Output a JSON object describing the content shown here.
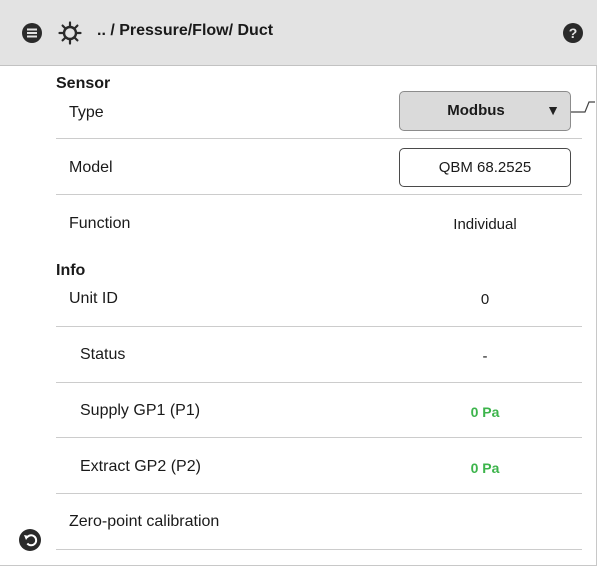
{
  "header": {
    "breadcrumb": ".. / Pressure/Flow/ Duct",
    "menu_icon": "menu-icon",
    "settings_icon": "gear-icon",
    "help_icon": "help-icon"
  },
  "sensor": {
    "title": "Sensor",
    "type_label": "Type",
    "type_value": "Modbus",
    "model_label": "Model",
    "model_value": "QBM 68.2525",
    "function_label": "Function",
    "function_value": "Individual"
  },
  "info": {
    "title": "Info",
    "unit_id_label": "Unit ID",
    "unit_id_value": "0",
    "status_label": "Status",
    "status_value": "-",
    "supply_label": "Supply GP1 (P1)",
    "supply_value": "0 Pa",
    "extract_label": "Extract GP2 (P2)",
    "extract_value": "0 Pa",
    "zero_point_label": "Zero-point calibration"
  },
  "footer": {
    "back_icon": "back-icon"
  },
  "colors": {
    "header_bg": "#e3e3e3",
    "value_green": "#3cb44b",
    "icon_dark": "#2a2a2a"
  }
}
